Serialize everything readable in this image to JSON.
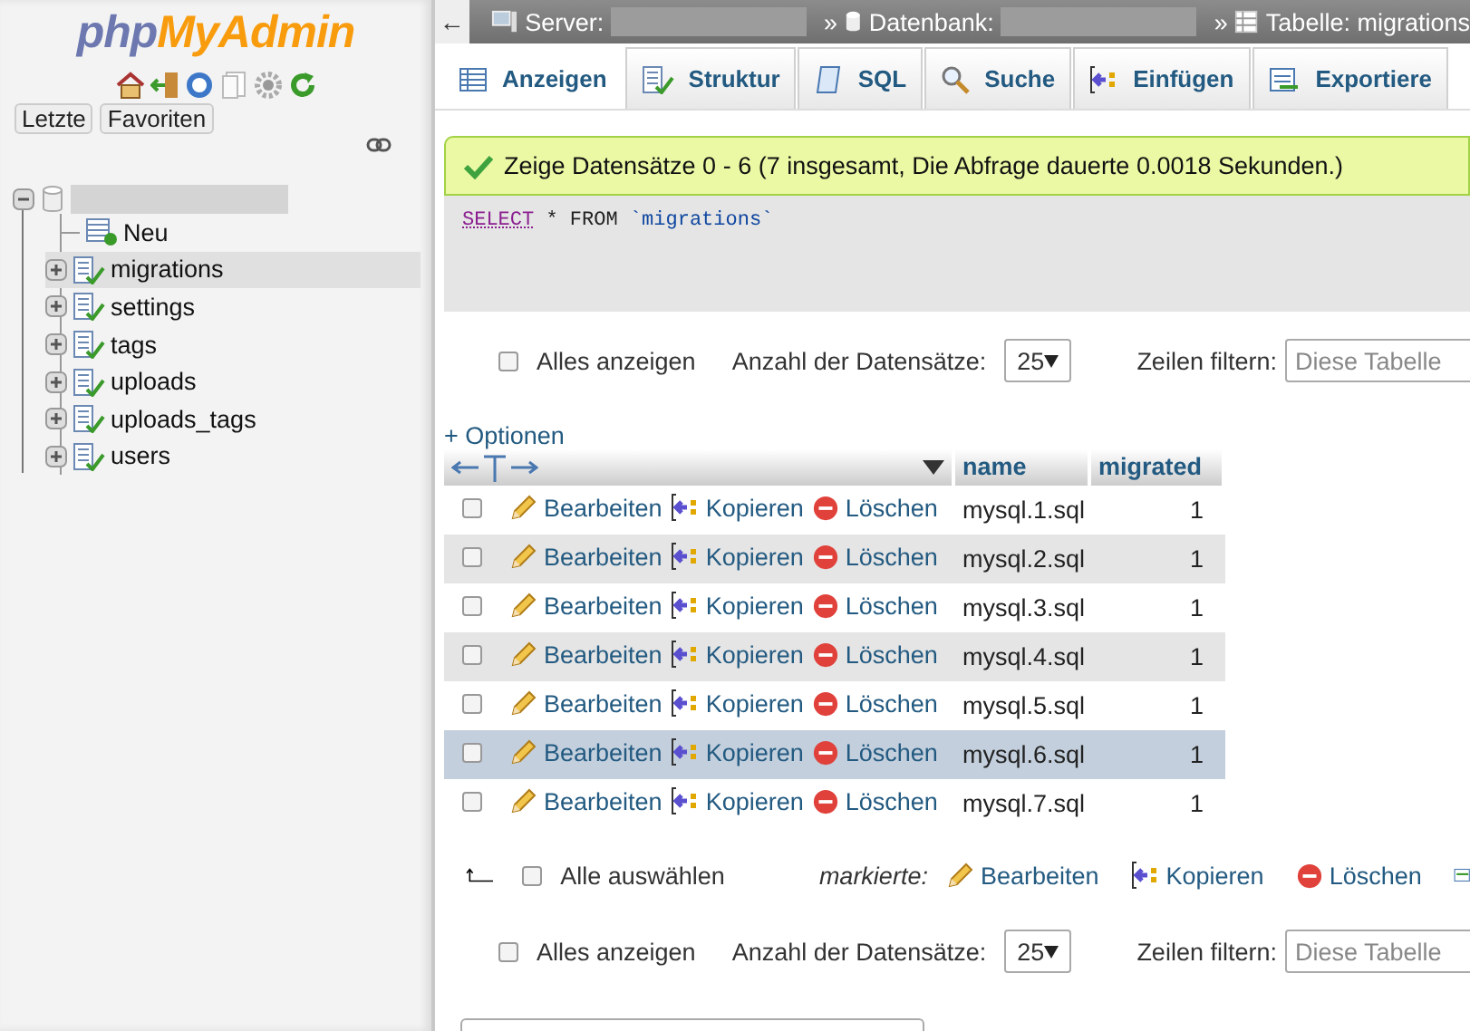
{
  "sidebar": {
    "logo": {
      "part_1": "php",
      "part_2": "MyAdmin"
    },
    "buttons": [
      {
        "label": "Letzte"
      },
      {
        "label": "Favoriten"
      }
    ],
    "tree": {
      "expanded": true,
      "children": [
        {
          "kind": "new",
          "label": "Neu",
          "selected": false
        },
        {
          "kind": "table",
          "label": "migrations",
          "selected": true
        },
        {
          "kind": "table",
          "label": "settings",
          "selected": false
        },
        {
          "kind": "table",
          "label": "tags",
          "selected": false
        },
        {
          "kind": "table",
          "label": "uploads",
          "selected": false
        },
        {
          "kind": "table",
          "label": "uploads_tags",
          "selected": false
        },
        {
          "kind": "table",
          "label": "users",
          "selected": false
        }
      ]
    }
  },
  "breadcrumb": {
    "back": "←",
    "server_label": "Server:",
    "separator_1": "»",
    "database_label": "Datenbank:",
    "separator_2": "»",
    "table_label": "Tabelle: migrations"
  },
  "tabs": [
    {
      "kind": "browse",
      "label": "Anzeigen",
      "selected": true
    },
    {
      "kind": "structure",
      "label": "Struktur",
      "selected": false
    },
    {
      "kind": "sql",
      "label": "SQL",
      "selected": false
    },
    {
      "kind": "search",
      "label": "Suche",
      "selected": false
    },
    {
      "kind": "insert",
      "label": "Einfügen",
      "selected": false
    },
    {
      "kind": "export",
      "label": "Exportiere",
      "selected": false
    }
  ],
  "message": "Zeige Datensätze 0 - 6 (7 insgesamt, Die Abfrage dauerte 0.0018 Sekunden.)",
  "query": {
    "keyword_1": "SELECT",
    "middle": "* FROM",
    "table": "`migrations`"
  },
  "nav_rows": [
    {
      "show_all": {
        "label": "Alles anzeigen",
        "checked": false
      },
      "count_label": "Anzahl der Datensätze:",
      "count_value": "25",
      "filter_label": "Zeilen filtern:",
      "filter_placeholder": "Diese Tabelle"
    }
  ],
  "options_link": "+ Optionen",
  "table": {
    "columns": [
      "name",
      "migrated"
    ],
    "rows": [
      {
        "checked": false,
        "highlighted": false,
        "actions": [
          "Bearbeiten",
          "Kopieren",
          "Löschen"
        ],
        "cells": [
          "mysql.1.sql",
          "1"
        ]
      },
      {
        "checked": false,
        "highlighted": false,
        "actions": [
          "Bearbeiten",
          "Kopieren",
          "Löschen"
        ],
        "cells": [
          "mysql.2.sql",
          "1"
        ]
      },
      {
        "checked": false,
        "highlighted": false,
        "actions": [
          "Bearbeiten",
          "Kopieren",
          "Löschen"
        ],
        "cells": [
          "mysql.3.sql",
          "1"
        ]
      },
      {
        "checked": false,
        "highlighted": false,
        "actions": [
          "Bearbeiten",
          "Kopieren",
          "Löschen"
        ],
        "cells": [
          "mysql.4.sql",
          "1"
        ]
      },
      {
        "checked": false,
        "highlighted": false,
        "actions": [
          "Bearbeiten",
          "Kopieren",
          "Löschen"
        ],
        "cells": [
          "mysql.5.sql",
          "1"
        ]
      },
      {
        "checked": false,
        "highlighted": true,
        "actions": [
          "Bearbeiten",
          "Kopieren",
          "Löschen"
        ],
        "cells": [
          "mysql.6.sql",
          "1"
        ]
      },
      {
        "checked": false,
        "highlighted": false,
        "actions": [
          "Bearbeiten",
          "Kopieren",
          "Löschen"
        ],
        "cells": [
          "mysql.7.sql",
          "1"
        ]
      }
    ]
  },
  "bulk": {
    "select_all": {
      "label": "Alle auswählen",
      "checked": false
    },
    "with_selected": "markierte:",
    "actions": [
      "Bearbeiten",
      "Kopieren",
      "Löschen"
    ]
  },
  "nav_rows_bottom": [
    {
      "show_all": {
        "label": "Alles anzeigen",
        "checked": false
      },
      "count_label": "Anzahl der Datensätze:",
      "count_value": "25",
      "filter_label": "Zeilen filtern:",
      "filter_placeholder": "Diese Tabelle"
    }
  ]
}
